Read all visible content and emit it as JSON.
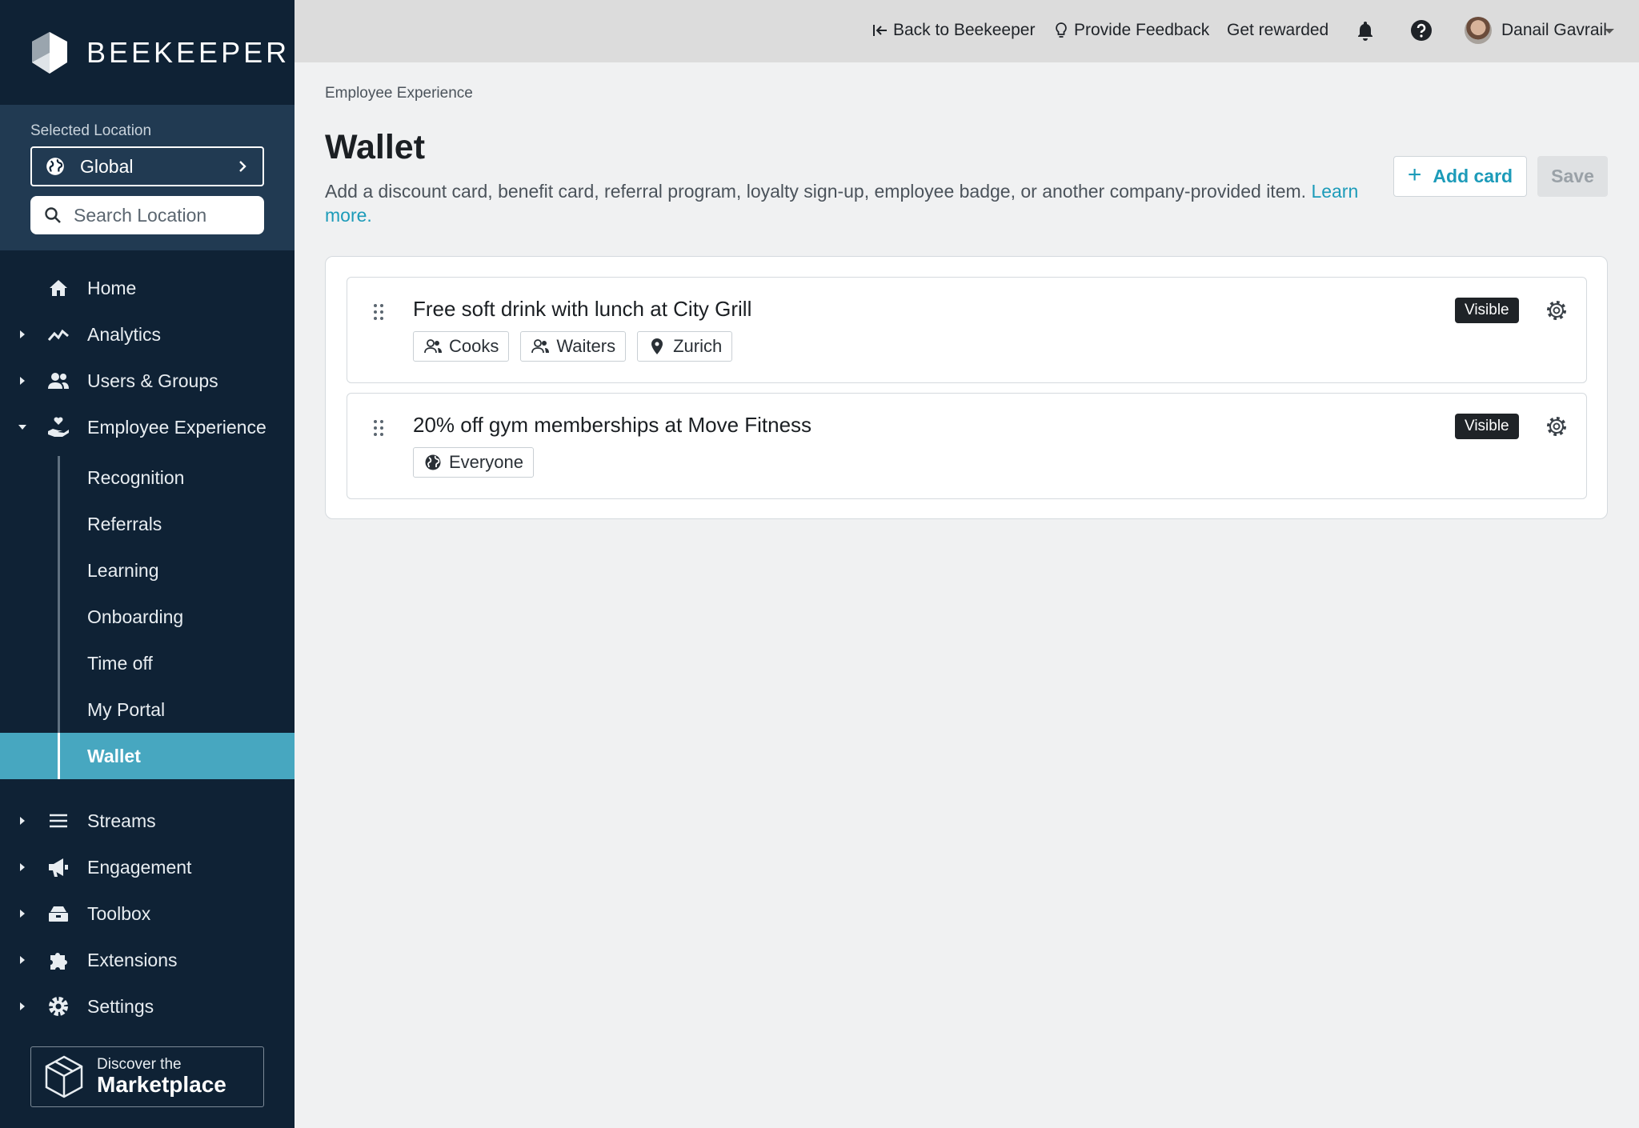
{
  "brand": {
    "name": "BEEKEEPER"
  },
  "location": {
    "label": "Selected Location",
    "selected": "Global",
    "search_placeholder": "Search Location"
  },
  "sidebar": {
    "items": [
      {
        "label": "Home",
        "icon": "home-icon"
      },
      {
        "label": "Analytics",
        "icon": "analytics-icon"
      },
      {
        "label": "Users & Groups",
        "icon": "users-icon"
      },
      {
        "label": "Employee Experience",
        "icon": "employee-experience-icon"
      }
    ],
    "sub_items": [
      {
        "label": "Recognition"
      },
      {
        "label": "Referrals"
      },
      {
        "label": "Learning"
      },
      {
        "label": "Onboarding"
      },
      {
        "label": "Time off"
      },
      {
        "label": "My Portal"
      },
      {
        "label": "Wallet",
        "active": true
      }
    ],
    "bottom_items": [
      {
        "label": "Streams",
        "icon": "streams-icon"
      },
      {
        "label": "Engagement",
        "icon": "megaphone-icon"
      },
      {
        "label": "Toolbox",
        "icon": "toolbox-icon"
      },
      {
        "label": "Extensions",
        "icon": "puzzle-icon"
      },
      {
        "label": "Settings",
        "icon": "gear-icon"
      }
    ],
    "marketplace": {
      "line1": "Discover the",
      "line2": "Marketplace"
    }
  },
  "topbar": {
    "back": "Back to Beekeeper",
    "feedback": "Provide Feedback",
    "rewarded": "Get rewarded",
    "user": "Danail Gavrail"
  },
  "main": {
    "breadcrumb": "Employee Experience",
    "title": "Wallet",
    "description": "Add a discount card, benefit card, referral program, loyalty sign-up, employee badge, or another company-provided item.",
    "learn_more": "Learn more.",
    "add_card": "Add card",
    "save": "Save",
    "cards": [
      {
        "title": "Free soft drink with lunch at City Grill",
        "status": "Visible",
        "tags": [
          {
            "label": "Cooks",
            "icon": "group-icon"
          },
          {
            "label": "Waiters",
            "icon": "group-icon"
          },
          {
            "label": "Zurich",
            "icon": "location-pin-icon"
          }
        ]
      },
      {
        "title": "20% off gym memberships at Move Fitness",
        "status": "Visible",
        "tags": [
          {
            "label": "Everyone",
            "icon": "globe-icon"
          }
        ]
      }
    ]
  },
  "colors": {
    "sidebar_bg": "#0f2235",
    "location_panel_bg": "#213a52",
    "accent": "#1c9bb9",
    "active_item_bg": "#47a7c0",
    "badge_bg": "#1f2327"
  }
}
